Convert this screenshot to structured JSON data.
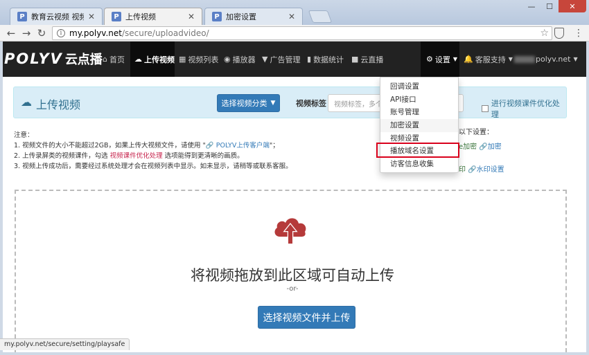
{
  "browser": {
    "tabs": [
      {
        "title": "教育云视频 视频托管 _(",
        "favicon": "P",
        "active": false
      },
      {
        "title": "上传视频",
        "favicon": "P",
        "active": true
      },
      {
        "title": "加密设置",
        "favicon": "P",
        "active": false
      }
    ],
    "window_controls": {
      "minimize": "—",
      "maximize": "☐",
      "close": "✕"
    },
    "url_host": "my.polyv.net",
    "url_path": "/secure/uploadvideo/",
    "status_url": "my.polyv.net/secure/setting/playsafe"
  },
  "site": {
    "logo_main": "POLYV",
    "logo_sub": "云点播",
    "nav": [
      {
        "label": "首页",
        "icon": "home-icon",
        "glyph": "⌂"
      },
      {
        "label": "上传视频",
        "icon": "upload-icon",
        "glyph": "☁"
      },
      {
        "label": "视频列表",
        "icon": "film-icon",
        "glyph": "▦"
      },
      {
        "label": "播放器",
        "icon": "play-circle-icon",
        "glyph": "◉"
      },
      {
        "label": "广告管理",
        "icon": "filter-icon",
        "glyph": "▼"
      },
      {
        "label": "数据统计",
        "icon": "bar-chart-icon",
        "glyph": "▮"
      },
      {
        "label": "云直播",
        "icon": "video-camera-icon",
        "glyph": "■"
      }
    ],
    "settings_label": "设置",
    "support_label": "客服支持",
    "user_label": "polyv.net"
  },
  "header": {
    "title": "上传视频",
    "category_button": "选择视频分类",
    "tag_label": "视频标签",
    "tag_placeholder": "视频标签，多个",
    "optimize_label": "进行视频课件优化处理"
  },
  "notes": {
    "heading": "注意：",
    "line1_a": "1. 视频文件的大小不能超过2GB，如果上传大视频文件，请使用 \"",
    "line1_link": "POLYV上传客户端",
    "line1_b": "\"；",
    "line2_a": "2. 上传录屏类的视频课件，勾选",
    "line2_red": "视频课件优化处理",
    "line2_b": "选项能得到更清晰的画质。",
    "line3": "3. 视频上传成功后，需要经过系统处理才会在视频列表中显示。如未显示，请稍等或联系客服。"
  },
  "right_notes": {
    "heading_fragment": "以下设置：",
    "encrypt_green": "e加密",
    "encrypt_link": "加密",
    "watermark_fragment": "印",
    "watermark_link": "水印设置"
  },
  "dropzone": {
    "title": "将视频拖放到此区域可自动上传",
    "or": "-or-",
    "button": "选择视频文件并上传"
  },
  "dropdown": {
    "items": [
      "回调设置",
      "API接口",
      "账号管理",
      "加密设置",
      "视频设置",
      "播放域名设置",
      "访客信息收集"
    ],
    "highlighted_index": 5
  },
  "colors": {
    "navbar": "#222222",
    "primary": "#337ab7",
    "info_bg": "#d9edf7",
    "info_text": "#31708f",
    "cloud_icon": "#b53a3a",
    "highlight": "#d9001b"
  }
}
